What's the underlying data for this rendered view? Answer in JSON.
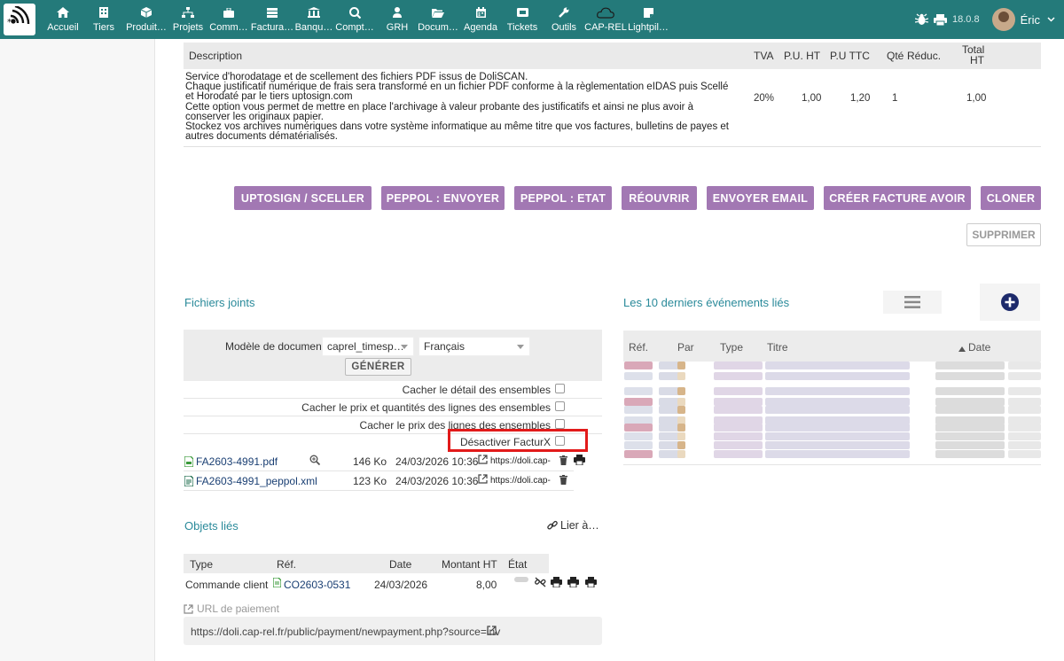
{
  "nav": {
    "items": [
      {
        "label": "Accueil",
        "icon": "home-icon"
      },
      {
        "label": "Tiers",
        "icon": "building-icon"
      },
      {
        "label": "Produit…",
        "icon": "cube-icon"
      },
      {
        "label": "Projets",
        "icon": "sitemap-icon"
      },
      {
        "label": "Comm…",
        "icon": "briefcase-icon"
      },
      {
        "label": "Factura…",
        "icon": "money-stack-icon"
      },
      {
        "label": "Banqu…",
        "icon": "bank-icon"
      },
      {
        "label": "Compt…",
        "icon": "search-dollar-icon"
      },
      {
        "label": "GRH",
        "icon": "user-tie-icon"
      },
      {
        "label": "Docum…",
        "icon": "folder-open-icon"
      },
      {
        "label": "Agenda",
        "icon": "calendar-icon"
      },
      {
        "label": "Tickets",
        "icon": "ticket-icon"
      },
      {
        "label": "Outils",
        "icon": "wrench-icon"
      },
      {
        "label": "CAP-REL",
        "icon": "cloud-icon"
      },
      {
        "label": "Lightpil…",
        "icon": "note-icon"
      }
    ],
    "version": "18.0.8",
    "user": "Éric",
    "color": "#247a7a"
  },
  "lines": {
    "headers": {
      "description": "Description",
      "tva": "TVA",
      "pu_ht": "P.U. HT",
      "pu_ttc": "P.U TTC",
      "qty": "Qté",
      "reduc": "Réduc.",
      "total1": "Total",
      "total2": "HT"
    },
    "row": {
      "desc1": "Service d'horodatage et de scellement des fichiers PDF issus de DoliSCAN.",
      "desc2": "Chaque justificatif numérique de frais sera transformé en un fichier PDF conforme à la règlementation eIDAS puis Scellé et Horodaté par le tiers uptosign.com",
      "desc3": "Cette option vous permet de mettre en place l'archivage à valeur probante des justificatifs et ainsi ne plus avoir à conserver les originaux papier.",
      "desc4": "Stockez vos archives numériques dans votre système informatique au même titre que vos factures, bulletins de payes et autres documents dématérialisés.",
      "tva": "20%",
      "pu_ht": "1,00",
      "pu_ttc": "1,20",
      "qty": "1",
      "total": "1,00"
    }
  },
  "actions": {
    "uptosign": "UPTOSIGN / SCELLER",
    "peppol_send": "PEPPOL : ENVOYER",
    "peppol_state": "PEPPOL : ETAT",
    "reopen": "RÉOUVRIR",
    "send_email": "ENVOYER EMAIL",
    "credit_note": "CRÉER FACTURE AVOIR",
    "clone": "CLONER",
    "delete": "SUPPRIMER",
    "accent": "#a278b3"
  },
  "files": {
    "title": "Fichiers joints",
    "model_label": "Modèle de document",
    "model_value": "caprel_timesp…",
    "lang_value": "Français",
    "generate": "GÉNÉRER",
    "options": [
      "Cacher le détail des ensembles",
      "Cacher le prix et quantités des lignes des ensembles",
      "Cacher le prix des lignes des ensembles",
      "Désactiver FacturX"
    ],
    "list": [
      {
        "name": "FA2603-4991.pdf",
        "size": "146 Ko",
        "date": "24/03/2026 10:36",
        "url": "https://doli.cap-"
      },
      {
        "name": "FA2603-4991_peppol.xml",
        "size": "123 Ko",
        "date": "24/03/2026 10:36",
        "url": "https://doli.cap-"
      }
    ]
  },
  "linked": {
    "title": "Objets liés",
    "link_action": "Lier à…",
    "headers": {
      "type": "Type",
      "ref": "Réf.",
      "date": "Date",
      "amount": "Montant HT",
      "state": "État"
    },
    "row": {
      "type": "Commande client",
      "ref": "CO2603-0531",
      "date": "24/03/2026",
      "amount": "8,00"
    },
    "payment_label": "URL de paiement",
    "payment_url": "https://doli.cap-rel.fr/public/payment/newpayment.php?source=inv"
  },
  "events": {
    "title": "Les 10 derniers événements liés",
    "headers": {
      "ref": "Réf.",
      "by": "Par",
      "type": "Type",
      "title": "Titre",
      "date": "Date"
    }
  }
}
